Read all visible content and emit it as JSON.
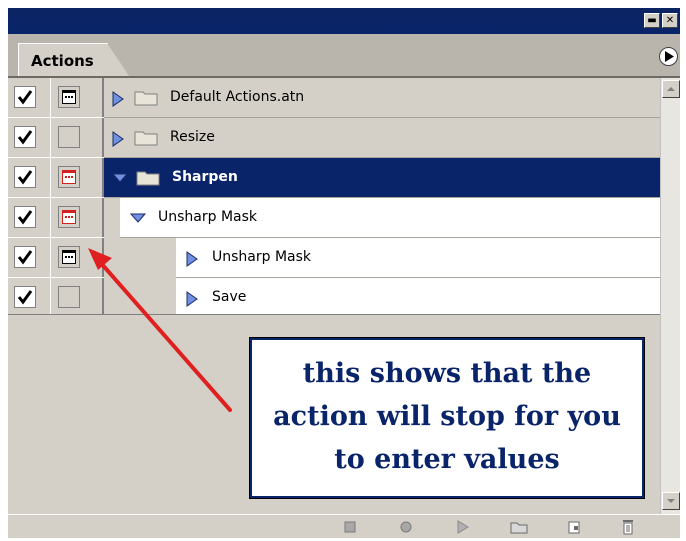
{
  "panel": {
    "tab_label": "Actions",
    "window_controls": {
      "minimize_icon": "minimize-icon",
      "close_icon": "close-icon"
    },
    "menu_icon": "panel-menu-arrow-icon"
  },
  "actions": [
    {
      "label": "Default Actions.atn",
      "checked": true,
      "dialog": "black",
      "type": "set",
      "expanded": false,
      "level": 0
    },
    {
      "label": "Resize",
      "checked": true,
      "dialog": "none",
      "type": "set",
      "expanded": false,
      "level": 0
    },
    {
      "label": "Sharpen",
      "checked": true,
      "dialog": "red",
      "type": "set",
      "expanded": true,
      "level": 0,
      "selected": true
    },
    {
      "label": "Unsharp Mask",
      "checked": true,
      "dialog": "red",
      "type": "action",
      "expanded": true,
      "level": 1
    },
    {
      "label": "Unsharp Mask",
      "checked": true,
      "dialog": "black",
      "type": "step",
      "expanded": false,
      "level": 2
    },
    {
      "label": "Save",
      "checked": true,
      "dialog": "none",
      "type": "step",
      "expanded": false,
      "level": 2
    }
  ],
  "toolbar": {
    "icons": [
      "stop-icon",
      "record-icon",
      "play-icon",
      "new-set-folder-icon",
      "new-action-icon",
      "delete-trash-icon"
    ]
  },
  "annotation": {
    "line1": "this shows that the",
    "line2": "action will stop for you",
    "line3": "to enter values"
  },
  "colors": {
    "selection": "#0a246a",
    "panel": "#d4d0c8",
    "dialog_red": "#d02020",
    "arrow_red": "#e02020",
    "callout_text": "#0a246a"
  }
}
